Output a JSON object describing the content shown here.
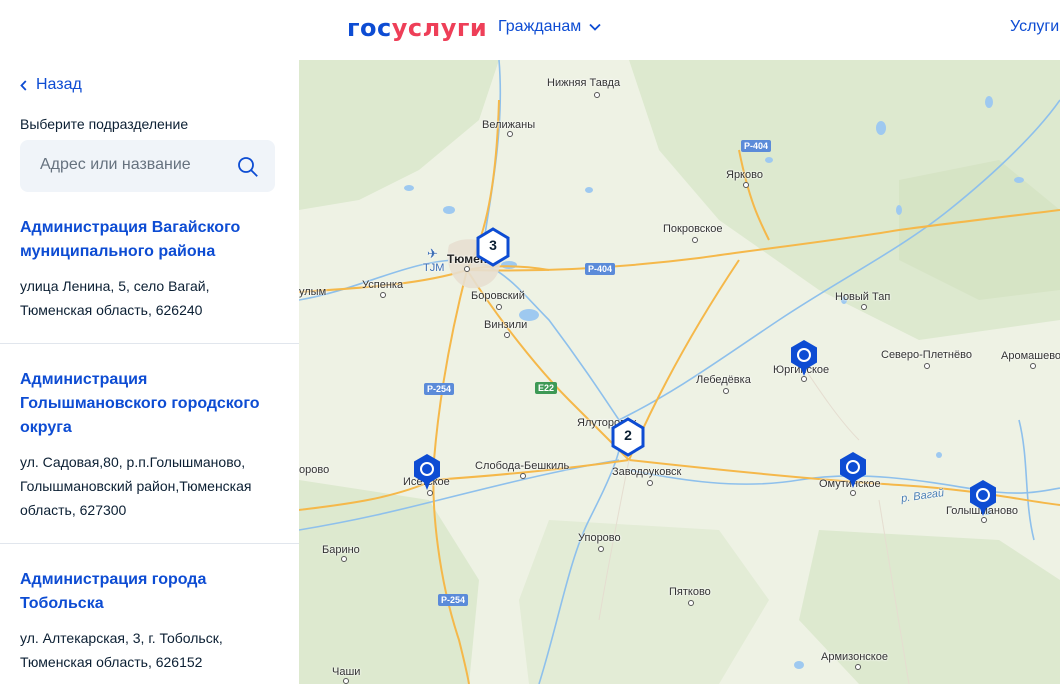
{
  "header": {
    "logo_part1": "гос",
    "logo_part2": "услуги",
    "nav_citizens": "Гражданам",
    "nav_services": "Услуги"
  },
  "sidebar": {
    "back_label": "Назад",
    "select_label": "Выберите подразделение",
    "search_placeholder": "Адрес или название",
    "items": [
      {
        "title": "Администрация Вагайского муниципального района",
        "address": "улица Ленина, 5, село Вагай, Тюменская область, 626240"
      },
      {
        "title": "Администрация Голышмановского городского округа",
        "address": "ул. Садовая,80, р.п.Голышманово, Голышмановский район,Тюменская область, 627300"
      },
      {
        "title": "Администрация города Тобольска",
        "address": "ул. Алтекарская, 3, г. Тобольск, Тюменская область, 626152"
      }
    ]
  },
  "map": {
    "clusters": [
      "3",
      "2"
    ],
    "roads": [
      "Р-404",
      "Р-404",
      "Р-254",
      "Е22",
      "Р-254"
    ],
    "airport": "TJM",
    "places": {
      "nizhnyaya_tavda": "Нижняя Тавда",
      "velizhany": "Велижаны",
      "yarkovo": "Ярково",
      "pokrovskoe": "Покровское",
      "tyumen": "Тюмень",
      "uspenka": "Успенка",
      "borovsky": "Боровский",
      "vinzili": "Винзили",
      "novy_tap": "Новый Тап",
      "severo_pletnevo": "Северо-Плетнёво",
      "aromashevo": "Аромашево",
      "yurginskoe": "Юргинское",
      "lebedevka": "Лебедёвка",
      "yalutorovsk": "Ялуторовск",
      "zavodoukovsk": "Заводоуковск",
      "sloboda_beshkil": "Слобода-Бешкиль",
      "isetskoe": "Исетское",
      "omutinskoe": "Омутинское",
      "golyshmanovo": "Голышманово",
      "barino": "Барино",
      "uporovo": "Упорово",
      "pyatkovo": "Пятково",
      "armizonskoe": "Армизонское",
      "chashi": "Чаши",
      "left_edge_1": "улым",
      "left_edge_2": "орово",
      "river_vagai": "р. Вагай"
    },
    "colors": {
      "pin": "#0d4cd3",
      "cluster_border": "#0d4cd3",
      "road": "#f5b84a",
      "water": "#9ec9f0",
      "forest": "#dde9cf"
    }
  }
}
